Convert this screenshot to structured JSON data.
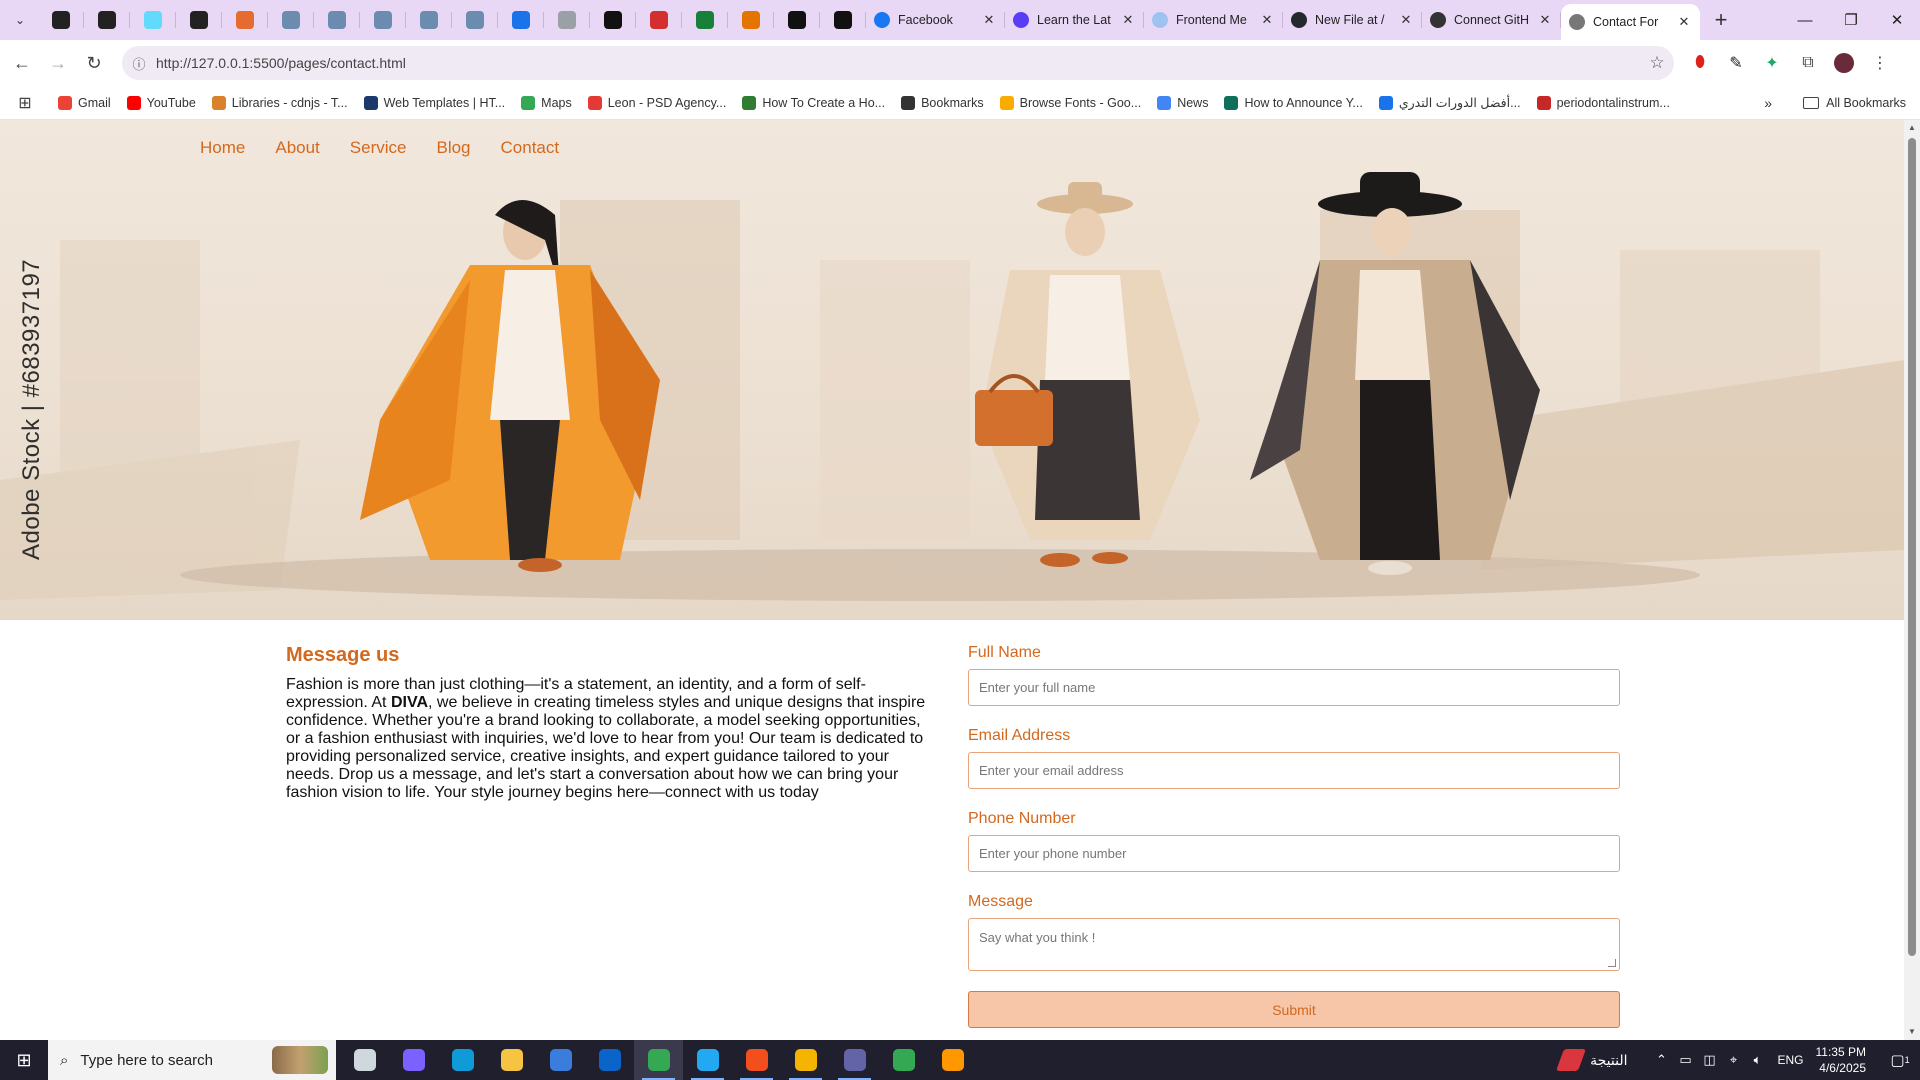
{
  "browser": {
    "tabs": [
      {
        "title": "Facebook",
        "color": "#1877f2"
      },
      {
        "title": "Learn the Lat",
        "color": "#5b3df5"
      },
      {
        "title": "Frontend Me",
        "color": "#9ec3f0"
      },
      {
        "title": "New File at /",
        "color": "#24292f"
      },
      {
        "title": "Connect GitH",
        "color": "#333333"
      },
      {
        "title": "Contact For",
        "color": "#777777",
        "active": true
      }
    ],
    "pinned_colors": [
      "#222222",
      "#222222",
      "#61dafb",
      "#222222",
      "#e56b2e",
      "#6b8cae",
      "#6b8cae",
      "#6b8cae",
      "#6b8cae",
      "#6b8cae",
      "#1a73e8",
      "#9aa0a6",
      "#111111",
      "#d32f2f",
      "#188038",
      "#e37400",
      "#111111",
      "#111111"
    ],
    "new_tab": "+",
    "window_controls": {
      "minimize": "—",
      "restore": "❐",
      "close": "✕"
    },
    "url": "http://127.0.0.1:5500/pages/contact.html",
    "bookmarks": [
      {
        "label": "Gmail",
        "color": "#ea4335"
      },
      {
        "label": "YouTube",
        "color": "#ff0000"
      },
      {
        "label": "Libraries - cdnjs - T...",
        "color": "#d9822b"
      },
      {
        "label": "Web Templates | HT...",
        "color": "#1b3a6b"
      },
      {
        "label": "Maps",
        "color": "#34a853"
      },
      {
        "label": "Leon - PSD Agency...",
        "color": "#e53935"
      },
      {
        "label": "How To Create a Ho...",
        "color": "#2e7d32"
      },
      {
        "label": "Bookmarks",
        "color": "#333333"
      },
      {
        "label": "Browse Fonts - Goo...",
        "color": "#f9ab00"
      },
      {
        "label": "News",
        "color": "#4285f4"
      },
      {
        "label": "How to Announce Y...",
        "color": "#0f6e5c"
      },
      {
        "label": "أفضل الدورات التدري...",
        "color": "#1a73e8"
      },
      {
        "label": "periodontalinstrum...",
        "color": "#c62828"
      }
    ],
    "all_bookmarks": "All Bookmarks",
    "more_bookmarks": "»"
  },
  "site": {
    "nav": [
      "Home",
      "About",
      "Service",
      "Blog",
      "Contact"
    ],
    "hero_credit": "Adobe Stock | #683937197",
    "message": {
      "title": "Message us",
      "body_before": "Fashion is more than just clothing—it's a statement, an identity, and a form of self-expression. At ",
      "brand": "DIVA",
      "body_after": ", we believe in creating timeless styles and unique designs that inspire confidence. Whether you're a brand looking to collaborate, a model seeking opportunities, or a fashion enthusiast with inquiries, we'd love to hear from you! Our team is dedicated to providing personalized service, creative insights, and expert guidance tailored to your needs. Drop us a message, and let's start a conversation about how we can bring your fashion vision to life. Your style journey begins here—connect with us today"
    },
    "form": {
      "full_name": {
        "label": "Full Name",
        "placeholder": "Enter your full name"
      },
      "email": {
        "label": "Email Address",
        "placeholder": "Enter your email address"
      },
      "phone": {
        "label": "Phone Number",
        "placeholder": "Enter your phone number"
      },
      "message": {
        "label": "Message",
        "placeholder": "Say what you think !"
      },
      "submit": "Submit"
    },
    "colors": {
      "accent": "#d2691e",
      "submit_bg": "#f7c5a8"
    }
  },
  "taskbar": {
    "search_placeholder": "Type here to search",
    "apps": [
      {
        "name": "task-view",
        "color": "#cfd8dc"
      },
      {
        "name": "copilot",
        "color": "#7b61ff"
      },
      {
        "name": "edge",
        "color": "#0f9bd7"
      },
      {
        "name": "file-explorer",
        "color": "#f6c343"
      },
      {
        "name": "store",
        "color": "#3b7ddd"
      },
      {
        "name": "outlook",
        "color": "#0a64c9"
      },
      {
        "name": "chrome",
        "color": "#34a853",
        "sel": true,
        "open": true
      },
      {
        "name": "vscode",
        "color": "#23a9f2",
        "open": true
      },
      {
        "name": "figma",
        "color": "#f24e1e",
        "open": true
      },
      {
        "name": "chrome-canary",
        "color": "#f4b400",
        "open": true
      },
      {
        "name": "teams",
        "color": "#6264a7",
        "open": true
      },
      {
        "name": "chrome-profile",
        "color": "#34a853"
      },
      {
        "name": "sublime",
        "color": "#ff9800"
      }
    ],
    "weather_text": "النتيجة",
    "language": "ENG",
    "time": "11:35 PM",
    "date": "4/6/2025",
    "notifications": "1"
  }
}
